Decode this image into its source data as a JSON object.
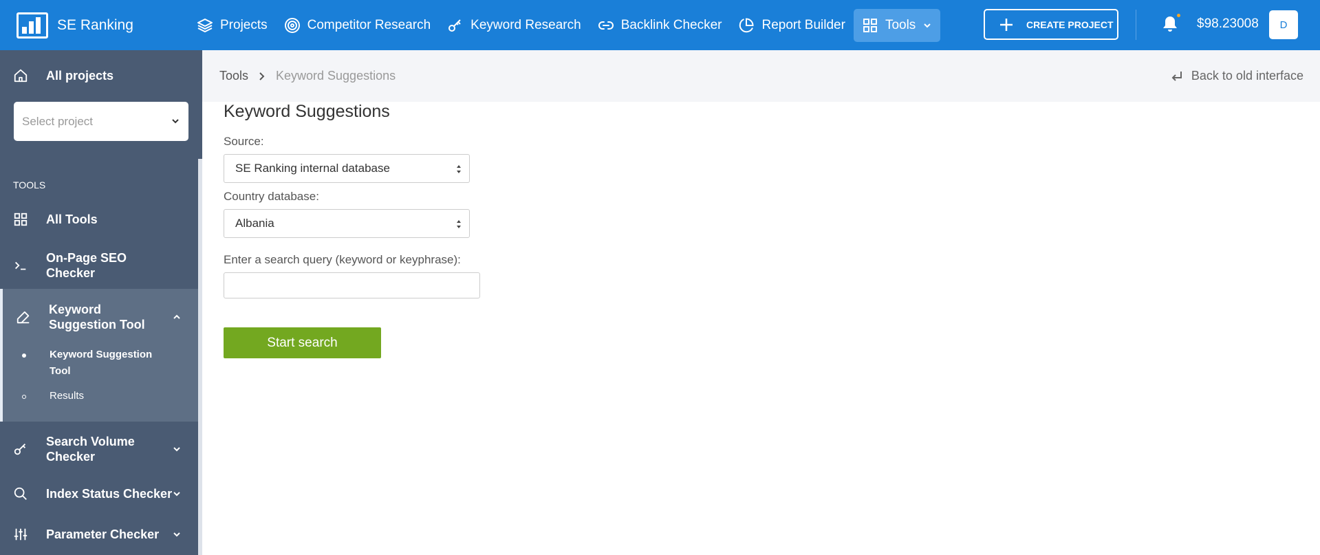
{
  "brand": {
    "name": "SE Ranking"
  },
  "nav": {
    "items": [
      {
        "label": "Projects",
        "icon": "layers-icon"
      },
      {
        "label": "Competitor Research",
        "icon": "target-icon"
      },
      {
        "label": "Keyword Research",
        "icon": "key-icon"
      },
      {
        "label": "Backlink Checker",
        "icon": "link-icon"
      },
      {
        "label": "Report Builder",
        "icon": "pie-chart-icon"
      },
      {
        "label": "Tools",
        "icon": "grid-icon",
        "active": true
      }
    ],
    "create_project": "CREATE PROJECT",
    "balance": "$98.23008",
    "avatar_initial": "D"
  },
  "sidebar": {
    "all_projects": "All projects",
    "select_project_placeholder": "Select project",
    "tools_heading": "TOOLS",
    "items": [
      {
        "label": "All Tools",
        "icon": "grid-icon"
      },
      {
        "label": "On-Page SEO Checker",
        "icon": "terminal-icon"
      },
      {
        "label": "Keyword Suggestion Tool",
        "icon": "edit-icon",
        "expanded": true
      },
      {
        "label": "Search Volume Checker",
        "icon": "key-icon"
      },
      {
        "label": "Index Status Checker",
        "icon": "search-icon"
      },
      {
        "label": "Parameter Checker",
        "icon": "sliders-icon"
      }
    ],
    "sub_items": [
      {
        "label": "Keyword Suggestion Tool",
        "active": true
      },
      {
        "label": "Results",
        "active": false
      }
    ]
  },
  "breadcrumb": {
    "root": "Tools",
    "current": "Keyword Suggestions",
    "back_link": "Back to old interface"
  },
  "main": {
    "title": "Keyword Suggestions",
    "source_label": "Source:",
    "source_value": "SE Ranking internal database",
    "country_label": "Country database:",
    "country_value": "Albania",
    "query_label": "Enter a search query (keyword or keyphrase):",
    "query_value": "",
    "start_button": "Start search"
  },
  "colors": {
    "topbar": "#1a7fd8",
    "sidebar": "#4a5b73",
    "sidebar_active": "#5e6f85",
    "primary_button": "#73a820"
  }
}
